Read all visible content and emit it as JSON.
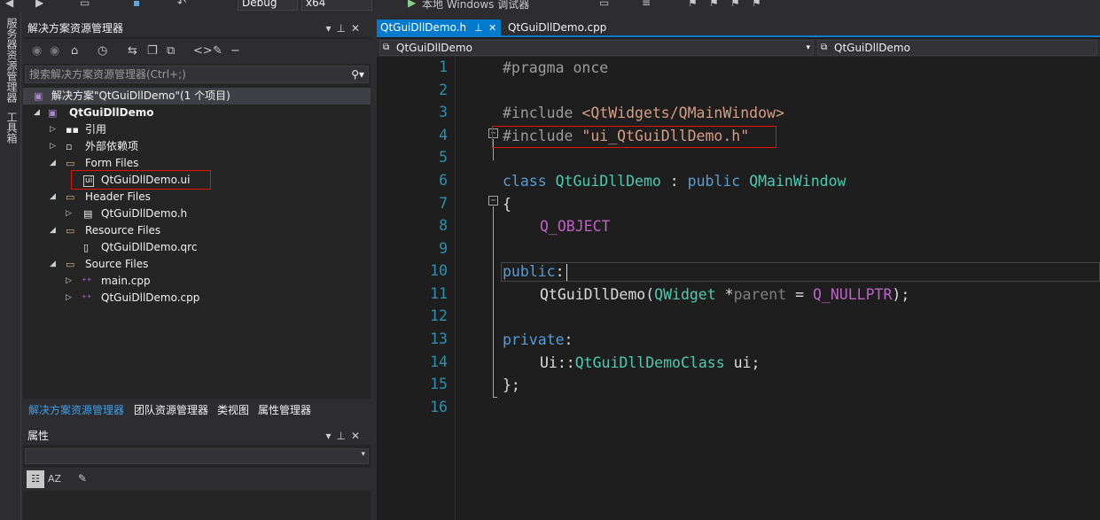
{
  "toolbar": {
    "config": "Debug",
    "platform": "x64",
    "run_target": "本地 Windows 调试器"
  },
  "left_strip": {
    "item1": "服务器资源管理器",
    "item2": "工具箱"
  },
  "solution_explorer": {
    "title": "解决方案资源管理器",
    "search_placeholder": "搜索解决方案资源管理器(Ctrl+;)",
    "tree": [
      {
        "label": "解决方案\"QtGuiDllDemo\"(1 个项目)",
        "icon": "solution-icon"
      },
      {
        "label": "QtGuiDllDemo",
        "icon": "project-icon"
      },
      {
        "label": "引用",
        "icon": "references-icon"
      },
      {
        "label": "外部依赖项",
        "icon": "external-deps-icon"
      },
      {
        "label": "Form Files",
        "icon": "folder-icon"
      },
      {
        "label": "QtGuiDllDemo.ui",
        "icon": "ui-file-icon"
      },
      {
        "label": "Header Files",
        "icon": "folder-icon"
      },
      {
        "label": "QtGuiDllDemo.h",
        "icon": "header-file-icon"
      },
      {
        "label": "Resource Files",
        "icon": "folder-icon"
      },
      {
        "label": "QtGuiDllDemo.qrc",
        "icon": "resource-file-icon"
      },
      {
        "label": "Source Files",
        "icon": "folder-icon"
      },
      {
        "label": "main.cpp",
        "icon": "cpp-file-icon"
      },
      {
        "label": "QtGuiDllDemo.cpp",
        "icon": "cpp-file-icon"
      }
    ],
    "bottom_tabs": [
      "解决方案资源管理器",
      "团队资源管理器",
      "类视图",
      "属性管理器"
    ]
  },
  "properties": {
    "title": "属性"
  },
  "editor": {
    "tabs": [
      "QtGuiDllDemo.h",
      "QtGuiDllDemo.cpp"
    ],
    "nav_left": "QtGuiDllDemo",
    "nav_right": "QtGuiDllDemo",
    "line_numbers": [
      "1",
      "2",
      "3",
      "4",
      "5",
      "6",
      "7",
      "8",
      "9",
      "10",
      "11",
      "12",
      "13",
      "14",
      "15",
      "16"
    ],
    "code": {
      "l1": "#pragma once",
      "l3_directive": "#include ",
      "l3_path": "<QtWidgets/QMainWindow>",
      "l4_directive": "#include ",
      "l4_path": "\"ui_QtGuiDllDemo.h\"",
      "l6_class": "class",
      "l6_name": "QtGuiDllDemo",
      "l6_colon": " : ",
      "l6_public": "public",
      "l6_base": "QMainWindow",
      "l7": "{",
      "l8": "Q_OBJECT",
      "l10_public": "public",
      "l10_colon": ":",
      "l11_ctor": "QtGuiDllDemo(",
      "l11_type": "QWidget",
      "l11_star": " *",
      "l11_param": "parent",
      "l11_eq": " = ",
      "l11_default": "Q_NULLPTR",
      "l11_end": ");",
      "l13_private": "private",
      "l13_colon": ":",
      "l14_ns": "Ui::",
      "l14_type": "QtGuiDllDemoClass",
      "l14_rest": " ui;",
      "l15": "};"
    }
  }
}
